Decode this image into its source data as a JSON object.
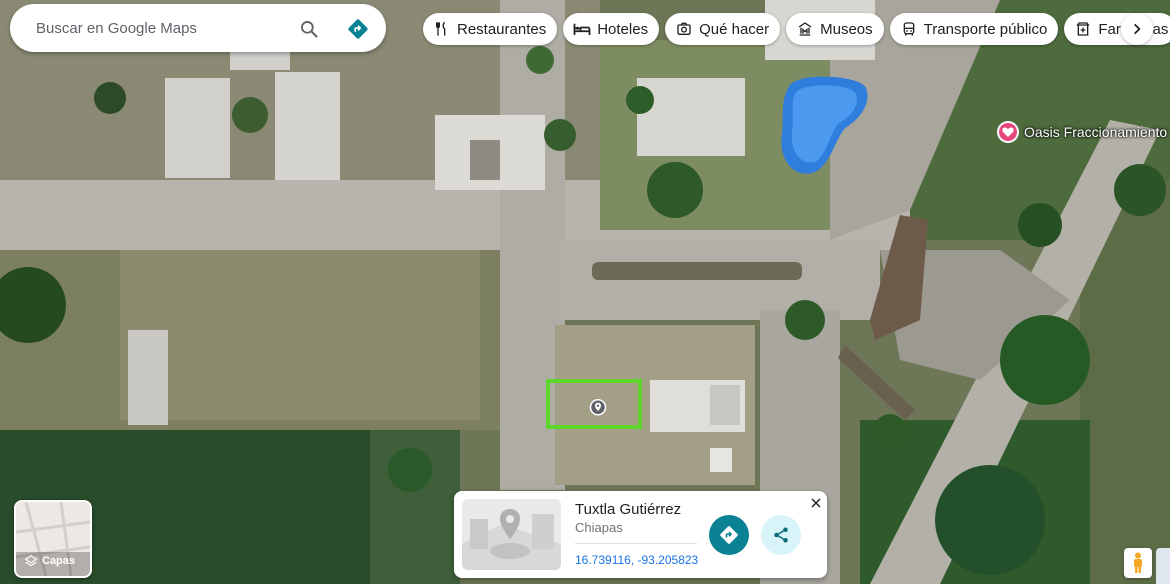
{
  "search": {
    "placeholder": "Buscar en Google Maps"
  },
  "icons": {
    "search": "search-icon",
    "directions": "directions-icon",
    "restaurants": "fork-knife-icon",
    "hotels": "bed-icon",
    "things_to_do": "camera-icon",
    "museums": "museum-icon",
    "transit": "bus-icon",
    "pharmacy": "pharmacy-icon",
    "more": "chevron-right-icon",
    "layers": "layers-icon",
    "share": "share-icon",
    "close": "close-icon",
    "pegman": "pegman-icon",
    "poi": "heart-pin-icon",
    "location_pin": "location-pin-icon"
  },
  "chips": [
    {
      "label": "Restaurantes"
    },
    {
      "label": "Hoteles"
    },
    {
      "label": "Qué hacer"
    },
    {
      "label": "Museos"
    },
    {
      "label": "Transporte público"
    },
    {
      "label": "Farmacias"
    }
  ],
  "poi": {
    "label": "Oasis Fraccionamiento"
  },
  "layers": {
    "label": "Capas"
  },
  "place_card": {
    "title": "Tuxtla Gutiérrez",
    "subtitle": "Chiapas",
    "coordinates": "16.739116, -93.205823"
  },
  "colors": {
    "directions_teal": "#0a8293",
    "share_bg": "#d9f4f8",
    "selection_green": "#5fd62a",
    "poi_pink": "#e8457a",
    "link_blue": "#1a73e8"
  }
}
